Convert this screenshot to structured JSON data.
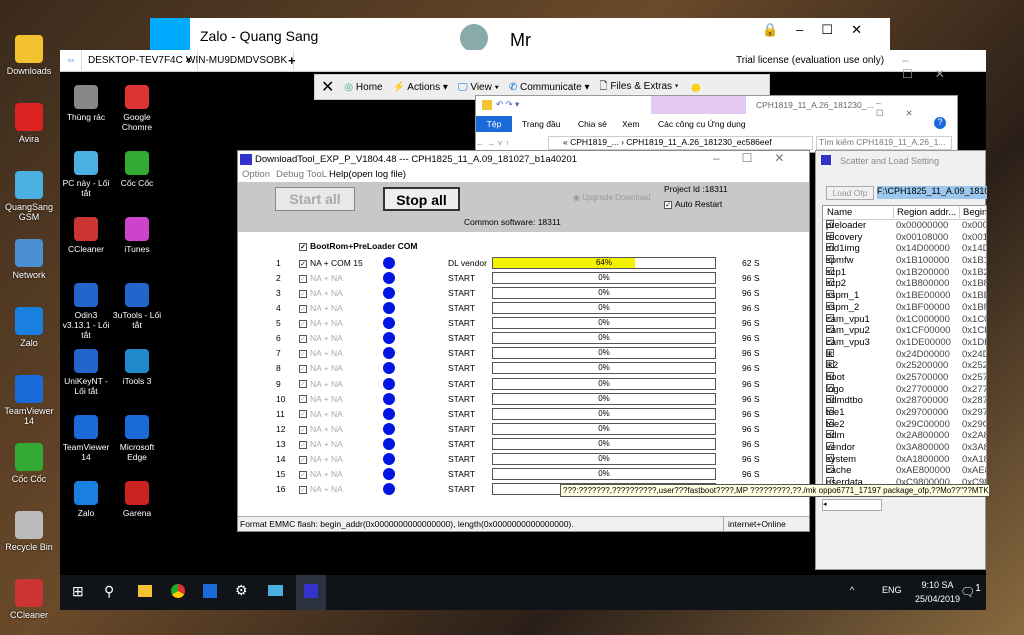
{
  "desktop_icons": [
    "Downloads",
    "Avira",
    "QuangSang GSM",
    "Network",
    "Zalo",
    "TeamViewer 14",
    "Cốc Cốc",
    "Recycle Bin",
    "CCleaner"
  ],
  "zalo": {
    "title": "Zalo - Quang Sang",
    "contact": "Mr"
  },
  "teamviewer": {
    "tabs": [
      "DESKTOP-TEV7F4C",
      "WIN-MU9DMDVSOBK"
    ],
    "add_tab": "+",
    "license": "Trial license (evaluation use only)",
    "toolbar": [
      "Home",
      "Actions",
      "View",
      "Communicate",
      "Files & Extras"
    ]
  },
  "remote_icons": [
    "Thùng rác",
    "Google Chomre",
    "PC này - Lối tắt",
    "Cốc Cốc",
    "CCleaner",
    "iTunes",
    "Odin3 v3.13.1 - Lối tắt",
    "3uTools - Lối tắt",
    "UniKeyNT - Lối tắt",
    "iTools 3",
    "TeamViewer 14",
    "Microsoft Edge",
    "Zalo",
    "Garena"
  ],
  "explorer": {
    "title": "CPH1819_11_A.26_181230_...",
    "tabs": [
      "Tệp",
      "Trang đầu",
      "Chia sẻ",
      "Xem",
      "Các công cụ Ứng dụng"
    ],
    "path": "« CPH1819_... › CPH1819_11_A.26_181230_ec586eef",
    "search_placeholder": "Tìm kiếm CPH1819_11_A.26_1..."
  },
  "downloadtool": {
    "title": "DownloadTool_EXP_P_V1804.48 --- CPH1825_11_A.09_181027_b1a40201",
    "menu": [
      "Option",
      "Debug TooL",
      "Help(open log file)"
    ],
    "start_all": "Start all",
    "stop_all": "Stop all",
    "upgrade": "Upgrade Download",
    "project_id": "Project Id :18311",
    "auto_restart": "Auto Restart",
    "auto_restart_checked": true,
    "common_software": "Common software: 18311",
    "bootrom": "BootRom+PreLoader COM",
    "rows": [
      {
        "n": "1",
        "port": "NA + COM 15",
        "status": "DL vendor",
        "progress": 64,
        "pct": "64%",
        "time": "62 S",
        "active": true
      },
      {
        "n": "2",
        "port": "NA + NA",
        "status": "START",
        "progress": 0,
        "pct": "0%",
        "time": "96 S"
      },
      {
        "n": "3",
        "port": "NA + NA",
        "status": "START",
        "progress": 0,
        "pct": "0%",
        "time": "96 S"
      },
      {
        "n": "4",
        "port": "NA + NA",
        "status": "START",
        "progress": 0,
        "pct": "0%",
        "time": "96 S"
      },
      {
        "n": "5",
        "port": "NA + NA",
        "status": "START",
        "progress": 0,
        "pct": "0%",
        "time": "96 S"
      },
      {
        "n": "6",
        "port": "NA + NA",
        "status": "START",
        "progress": 0,
        "pct": "0%",
        "time": "96 S"
      },
      {
        "n": "7",
        "port": "NA + NA",
        "status": "START",
        "progress": 0,
        "pct": "0%",
        "time": "96 S"
      },
      {
        "n": "8",
        "port": "NA + NA",
        "status": "START",
        "progress": 0,
        "pct": "0%",
        "time": "96 S"
      },
      {
        "n": "9",
        "port": "NA + NA",
        "status": "START",
        "progress": 0,
        "pct": "0%",
        "time": "96 S"
      },
      {
        "n": "10",
        "port": "NA + NA",
        "status": "START",
        "progress": 0,
        "pct": "0%",
        "time": "96 S"
      },
      {
        "n": "11",
        "port": "NA + NA",
        "status": "START",
        "progress": 0,
        "pct": "0%",
        "time": "96 S"
      },
      {
        "n": "12",
        "port": "NA + NA",
        "status": "START",
        "progress": 0,
        "pct": "0%",
        "time": "96 S"
      },
      {
        "n": "13",
        "port": "NA + NA",
        "status": "START",
        "progress": 0,
        "pct": "0%",
        "time": "96 S"
      },
      {
        "n": "14",
        "port": "NA + NA",
        "status": "START",
        "progress": 0,
        "pct": "0%",
        "time": "96 S"
      },
      {
        "n": "15",
        "port": "NA + NA",
        "status": "START",
        "progress": 0,
        "pct": "0%",
        "time": "96 S"
      },
      {
        "n": "16",
        "port": "NA + NA",
        "status": "START",
        "progress": 0,
        "pct": "",
        "time": ""
      }
    ],
    "tooltip": "???:???????,??????????,user???fastboot????,MP ?????????,??./mk oppo6771_17197 package_ofp,??Mo??\"??MTK??????\",??!",
    "status_left": "Format EMMC flash:  begin_addr(0x0000000000000000), length(0x0000000000000000).",
    "status_right": "internet+Online"
  },
  "scatter": {
    "title": "Scatter and Load Setting",
    "load_ofp": "Load Ofp",
    "path": "F:\\CPH1825_11_A.09_18102",
    "columns": [
      "Name",
      "Region addr...",
      "Begin"
    ],
    "rows": [
      [
        "preloader",
        "0x00000000",
        "0x0000"
      ],
      [
        "recovery",
        "0x00108000",
        "0x0010"
      ],
      [
        "md1img",
        "0x14D00000",
        "0x14D"
      ],
      [
        "spmfw",
        "0x1B100000",
        "0x1B1"
      ],
      [
        "scp1",
        "0x1B200000",
        "0x1B2"
      ],
      [
        "scp2",
        "0x1B800000",
        "0x1B8"
      ],
      [
        "sspm_1",
        "0x1BE00000",
        "0x1BE"
      ],
      [
        "sspm_2",
        "0x1BF00000",
        "0x1BF"
      ],
      [
        "cam_vpu1",
        "0x1C000000",
        "0x1C0"
      ],
      [
        "cam_vpu2",
        "0x1CF00000",
        "0x1CF"
      ],
      [
        "cam_vpu3",
        "0x1DE00000",
        "0x1DE"
      ],
      [
        "lk",
        "0x24D00000",
        "0x24D"
      ],
      [
        "lk2",
        "0x25200000",
        "0x252"
      ],
      [
        "boot",
        "0x25700000",
        "0x257"
      ],
      [
        "logo",
        "0x27700000",
        "0x277"
      ],
      [
        "odmdtbo",
        "0x28700000",
        "0x287"
      ],
      [
        "tee1",
        "0x29700000",
        "0x297"
      ],
      [
        "tee2",
        "0x29C00000",
        "0x29C"
      ],
      [
        "odm",
        "0x2A800000",
        "0x2A8"
      ],
      [
        "vendor",
        "0x3A800000",
        "0x3A8"
      ],
      [
        "system",
        "0xA1800000",
        "0xA18"
      ],
      [
        "cache",
        "0xAE800000",
        "0xAE8"
      ],
      [
        "userdata",
        "0xC9800000",
        "0xC98"
      ]
    ]
  },
  "taskbar": {
    "lang": "ENG",
    "time": "9:10 SA",
    "date": "25/04/2019",
    "notif": "1"
  }
}
